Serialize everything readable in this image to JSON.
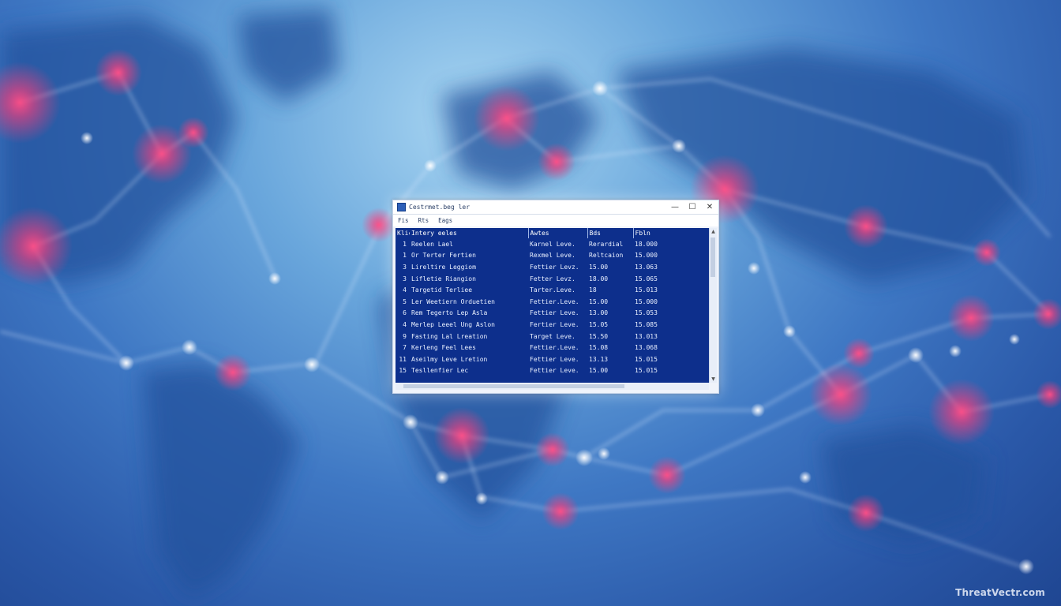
{
  "window": {
    "title": "Cestrmet.beg ler",
    "minimize_glyph": "—",
    "maximize_glyph": "☐",
    "close_glyph": "✕"
  },
  "menu": [
    "Fis",
    "Rts",
    "Eags"
  ],
  "table": {
    "columns": [
      "Klic",
      "Intery eeles",
      "Awtes",
      "Bds",
      "Fbln"
    ],
    "rows": [
      {
        "id": "1",
        "name": "Reelen Lael",
        "a": "Karnel Leve.",
        "b": "Rerardial",
        "c": "18.000"
      },
      {
        "id": "1",
        "name": "Or Terter Fertien",
        "a": "Rexmel Leve.",
        "b": "Reltcaion",
        "c": "15.000"
      },
      {
        "id": "3",
        "name": "Lireltire Leggiom",
        "a": "Fettier Levz.",
        "b": "15.00",
        "c": "13.063"
      },
      {
        "id": "3",
        "name": "Lifletie Riangion",
        "a": "Fetter Levz.",
        "b": "18.00",
        "c": "15.065"
      },
      {
        "id": "4",
        "name": "Targetid Terliee",
        "a": "Tarter.Leve.",
        "b": "18",
        "c": "15.013"
      },
      {
        "id": "5",
        "name": "Ler Weetiern Orduetien",
        "a": "Fettier.Leve.",
        "b": "15.00",
        "c": "15.000"
      },
      {
        "id": "6",
        "name": "Rem Tegerto Lep Asla",
        "a": "Fettier Leve.",
        "b": "13.00",
        "c": "15.053"
      },
      {
        "id": "4",
        "name": "Merlep Leeel Ung Aslon",
        "a": "Fertier Leve.",
        "b": "15.05",
        "c": "15.085"
      },
      {
        "id": "9",
        "name": "Fasting Lal Lreation",
        "a": "Target Leve.",
        "b": "15.50",
        "c": "13.013"
      },
      {
        "id": "7",
        "name": "Kerleng Feel Lees",
        "a": "Fettier.Leve.",
        "b": "15.08",
        "c": "13.068"
      },
      {
        "id": "11",
        "name": "Aseilmy Leve Lretion",
        "a": "Fettier Leve.",
        "b": "13.13",
        "c": "15.015"
      },
      {
        "id": "15",
        "name": "Tesllenfier Lec",
        "a": "Fettier Leve.",
        "b": "15.00",
        "c": "15.015"
      }
    ]
  },
  "watermark": "ThreatVectr.com",
  "colors": {
    "content_bg": "#0d2f8c",
    "node_pink": "#ff3d7a"
  }
}
